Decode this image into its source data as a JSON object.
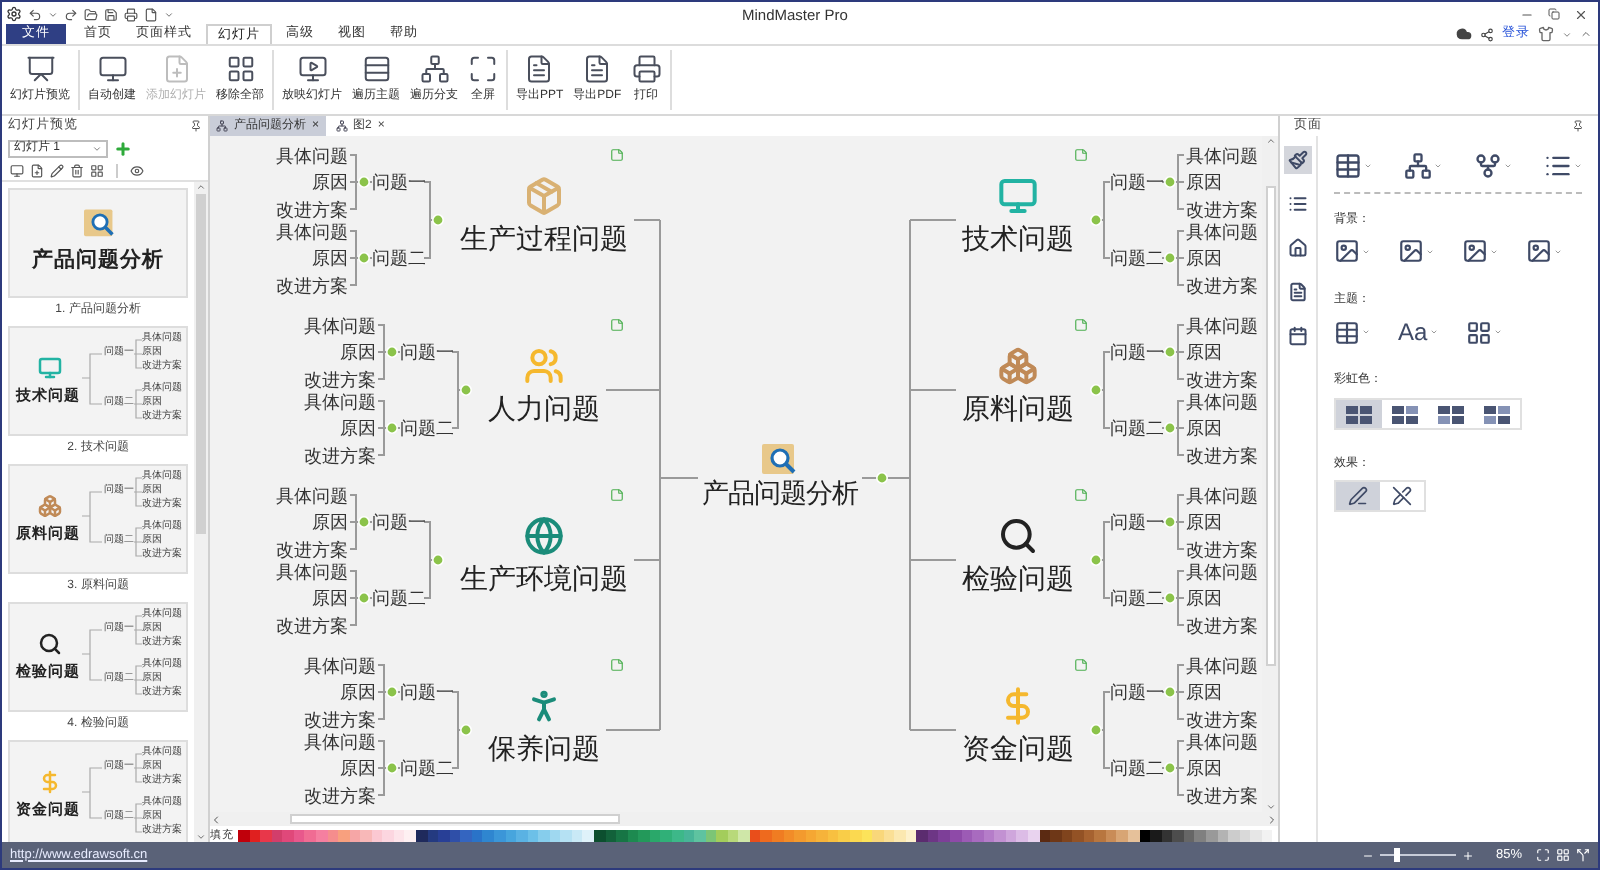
{
  "window": {
    "title": "MindMaster Pro"
  },
  "menu": {
    "tabs": [
      {
        "label": "文件",
        "kind": "file",
        "selected": false
      },
      {
        "label": "首页",
        "kind": "tab",
        "selected": false
      },
      {
        "label": "页面样式",
        "kind": "tab",
        "selected": false
      },
      {
        "label": "幻灯片",
        "kind": "tab",
        "selected": true
      },
      {
        "label": "高级",
        "kind": "tab",
        "selected": false
      },
      {
        "label": "视图",
        "kind": "tab",
        "selected": false
      },
      {
        "label": "帮助",
        "kind": "tab",
        "selected": false
      }
    ],
    "login": "登录"
  },
  "ribbon": {
    "groups": [
      {
        "buttons": [
          {
            "label": "幻灯片预览",
            "disabled": false
          }
        ]
      },
      {
        "buttons": [
          {
            "label": "自动创建",
            "disabled": false
          },
          {
            "label": "添加幻灯片",
            "disabled": true
          },
          {
            "label": "移除全部",
            "disabled": false
          }
        ]
      },
      {
        "buttons": [
          {
            "label": "放映幻灯片",
            "disabled": false
          },
          {
            "label": "遍历主题",
            "disabled": false
          },
          {
            "label": "遍历分支",
            "disabled": false
          },
          {
            "label": "全屏",
            "disabled": false
          }
        ]
      },
      {
        "buttons": [
          {
            "label": "导出PPT",
            "disabled": false
          },
          {
            "label": "导出PDF",
            "disabled": false
          },
          {
            "label": "打印",
            "disabled": false
          }
        ]
      }
    ]
  },
  "left_panel": {
    "title": "幻灯片预览",
    "slide_select": "幻灯片 1",
    "slides": [
      {
        "kind": "cover",
        "title": "产品问题分析",
        "caption": "1. 产品问题分析"
      },
      {
        "kind": "map",
        "title": "技术问题",
        "caption": "2. 技术问题",
        "branches": [
          {
            "label": "问题一",
            "children": [
              "具体问题",
              "原因",
              "改进方案"
            ]
          },
          {
            "label": "问题二",
            "children": [
              "具体问题",
              "原因",
              "改进方案"
            ]
          }
        ]
      },
      {
        "kind": "map",
        "title": "原料问题",
        "caption": "3. 原料问题",
        "branches": [
          {
            "label": "问题一",
            "children": [
              "具体问题",
              "原因",
              "改进方案"
            ]
          },
          {
            "label": "问题二",
            "children": [
              "具体问题",
              "原因",
              "改进方案"
            ]
          }
        ]
      },
      {
        "kind": "map",
        "title": "检验问题",
        "caption": "4. 检验问题",
        "branches": [
          {
            "label": "问题一",
            "children": [
              "具体问题",
              "原因",
              "改进方案"
            ]
          },
          {
            "label": "问题二",
            "children": [
              "具体问题",
              "原因",
              "改进方案"
            ]
          }
        ]
      },
      {
        "kind": "map",
        "title": "资金问题",
        "branches": [
          {
            "label": "问题一",
            "children": [
              "具体问题",
              "原因",
              "改进方案"
            ]
          },
          {
            "label": "问题二",
            "children": [
              "具体问题",
              "原因",
              "改进方案"
            ]
          }
        ]
      }
    ]
  },
  "doc_tabs": [
    {
      "label": "产品问题分析",
      "close": "×",
      "selected": true
    },
    {
      "label": "图2",
      "close": "×",
      "selected": false
    }
  ],
  "mindmap": {
    "central": "产品问题分析",
    "left": [
      {
        "title": "生产过程问题",
        "subtopics": [
          {
            "label": "问题一",
            "children": [
              "具体问题",
              "原因",
              "改进方案"
            ]
          },
          {
            "label": "问题二",
            "children": [
              "具体问题",
              "原因",
              "改进方案"
            ]
          }
        ]
      },
      {
        "title": "人力问题",
        "subtopics": [
          {
            "label": "问题一",
            "children": [
              "具体问题",
              "原因",
              "改进方案"
            ]
          },
          {
            "label": "问题二",
            "children": [
              "具体问题",
              "原因",
              "改进方案"
            ]
          }
        ]
      },
      {
        "title": "生产环境问题",
        "subtopics": [
          {
            "label": "问题一",
            "children": [
              "具体问题",
              "原因",
              "改进方案"
            ]
          },
          {
            "label": "问题二",
            "children": [
              "具体问题",
              "原因",
              "改进方案"
            ]
          }
        ]
      },
      {
        "title": "保养问题",
        "subtopics": [
          {
            "label": "问题一",
            "children": [
              "具体问题",
              "原因",
              "改进方案"
            ]
          },
          {
            "label": "问题二",
            "children": [
              "具体问题",
              "原因",
              "改进方案"
            ]
          }
        ]
      }
    ],
    "right": [
      {
        "title": "技术问题",
        "subtopics": [
          {
            "label": "问题一",
            "children": [
              "具体问题",
              "原因",
              "改进方案"
            ]
          },
          {
            "label": "问题二",
            "children": [
              "具体问题",
              "原因",
              "改进方案"
            ]
          }
        ]
      },
      {
        "title": "原料问题",
        "subtopics": [
          {
            "label": "问题一",
            "children": [
              "具体问题",
              "原因",
              "改进方案"
            ]
          },
          {
            "label": "问题二",
            "children": [
              "具体问题",
              "原因",
              "改进方案"
            ]
          }
        ]
      },
      {
        "title": "检验问题",
        "subtopics": [
          {
            "label": "问题一",
            "children": [
              "具体问题",
              "原因",
              "改进方案"
            ]
          },
          {
            "label": "问题二",
            "children": [
              "具体问题",
              "原因",
              "改进方案"
            ]
          }
        ]
      },
      {
        "title": "资金问题",
        "subtopics": [
          {
            "label": "问题一",
            "children": [
              "具体问题",
              "原因",
              "改进方案"
            ]
          },
          {
            "label": "问题二",
            "children": [
              "具体问题",
              "原因",
              "改进方案"
            ]
          }
        ]
      }
    ]
  },
  "right_panel": {
    "title": "页面",
    "tabs": [
      {
        "selected": true
      },
      {
        "selected": false
      },
      {
        "selected": false
      },
      {
        "selected": false
      },
      {
        "selected": false
      }
    ],
    "background_label": "背景：",
    "theme_label": "主题：",
    "theme_font_sample": "Aa",
    "rainbow_label": "彩虹色：",
    "rainbow_options": [
      {
        "selected": true
      },
      {
        "selected": false
      },
      {
        "selected": false
      },
      {
        "selected": false
      }
    ],
    "effect_label": "效果：",
    "effect_options": [
      {
        "selected": true
      },
      {
        "selected": false
      }
    ]
  },
  "palette": {
    "label": "填充",
    "swatches": [
      {
        "color": "#c0000b"
      },
      {
        "color": "#e0201f"
      },
      {
        "color": "#e8374a"
      },
      {
        "color": "#d23e6b"
      },
      {
        "color": "#e0487a"
      },
      {
        "color": "#e8588c"
      },
      {
        "color": "#f06c93"
      },
      {
        "color": "#f57fa0"
      },
      {
        "color": "#f58d8d"
      },
      {
        "color": "#f8a07e"
      },
      {
        "color": "#f6a6a6"
      },
      {
        "color": "#f8b8b8"
      },
      {
        "color": "#fbc8d2"
      },
      {
        "color": "#fcd6e0"
      },
      {
        "color": "#fde4ea"
      },
      {
        "color": "#fef0f2"
      },
      {
        "color": "#1f2a5c"
      },
      {
        "color": "#243a80"
      },
      {
        "color": "#283f96"
      },
      {
        "color": "#2f4fa8"
      },
      {
        "color": "#3465c0"
      },
      {
        "color": "#2a73c8"
      },
      {
        "color": "#2f86d0"
      },
      {
        "color": "#3b96d8"
      },
      {
        "color": "#47a5dd"
      },
      {
        "color": "#5ab2e3"
      },
      {
        "color": "#6cc0e8"
      },
      {
        "color": "#86cdec"
      },
      {
        "color": "#9fd8f0"
      },
      {
        "color": "#b5e1f3"
      },
      {
        "color": "#c9e9f6"
      },
      {
        "color": "#dff2fa"
      },
      {
        "color": "#0c4f2f"
      },
      {
        "color": "#12613a"
      },
      {
        "color": "#177545"
      },
      {
        "color": "#1d8a50"
      },
      {
        "color": "#23995a"
      },
      {
        "color": "#2aa86a"
      },
      {
        "color": "#30b078"
      },
      {
        "color": "#3db889"
      },
      {
        "color": "#48b598"
      },
      {
        "color": "#5ec3a0"
      },
      {
        "color": "#7cc576"
      },
      {
        "color": "#a3cd5b"
      },
      {
        "color": "#b8d97a"
      },
      {
        "color": "#cfe7a8"
      },
      {
        "color": "#e94e1b"
      },
      {
        "color": "#ee6a1e"
      },
      {
        "color": "#f07c22"
      },
      {
        "color": "#f28c28"
      },
      {
        "color": "#f39a2e"
      },
      {
        "color": "#f5a733"
      },
      {
        "color": "#f6b33a"
      },
      {
        "color": "#f8c040"
      },
      {
        "color": "#f9cd48"
      },
      {
        "color": "#fbd950"
      },
      {
        "color": "#fce35a"
      },
      {
        "color": "#f9d77a"
      },
      {
        "color": "#fadf95"
      },
      {
        "color": "#fbe8b0"
      },
      {
        "color": "#fdf1cc"
      },
      {
        "color": "#5b2c6f"
      },
      {
        "color": "#6d3685"
      },
      {
        "color": "#7d3f98"
      },
      {
        "color": "#8e4aa8"
      },
      {
        "color": "#9c5bb5"
      },
      {
        "color": "#a86bbf"
      },
      {
        "color": "#b57dc9"
      },
      {
        "color": "#c291d2"
      },
      {
        "color": "#cfa6dc"
      },
      {
        "color": "#dcbce6"
      },
      {
        "color": "#e9d3ef"
      },
      {
        "color": "#5b2a12"
      },
      {
        "color": "#6e3717"
      },
      {
        "color": "#80441d"
      },
      {
        "color": "#935225"
      },
      {
        "color": "#a66230"
      },
      {
        "color": "#b8763f"
      },
      {
        "color": "#c98c57"
      },
      {
        "color": "#d8a574"
      },
      {
        "color": "#e6c19a"
      },
      {
        "color": "#000000"
      },
      {
        "color": "#1a1a1a"
      },
      {
        "color": "#333333"
      },
      {
        "color": "#4d4d4d"
      },
      {
        "color": "#666666"
      },
      {
        "color": "#808080"
      },
      {
        "color": "#999999"
      },
      {
        "color": "#b3b3b3"
      },
      {
        "color": "#cccccc"
      },
      {
        "color": "#d9d9d9"
      },
      {
        "color": "#e6e6e6"
      },
      {
        "color": "#f2f2f2"
      }
    ]
  },
  "status_bar": {
    "link": "http://www.edrawsoft.cn",
    "zoom": {
      "level": 0.23,
      "reading": "85%"
    }
  }
}
